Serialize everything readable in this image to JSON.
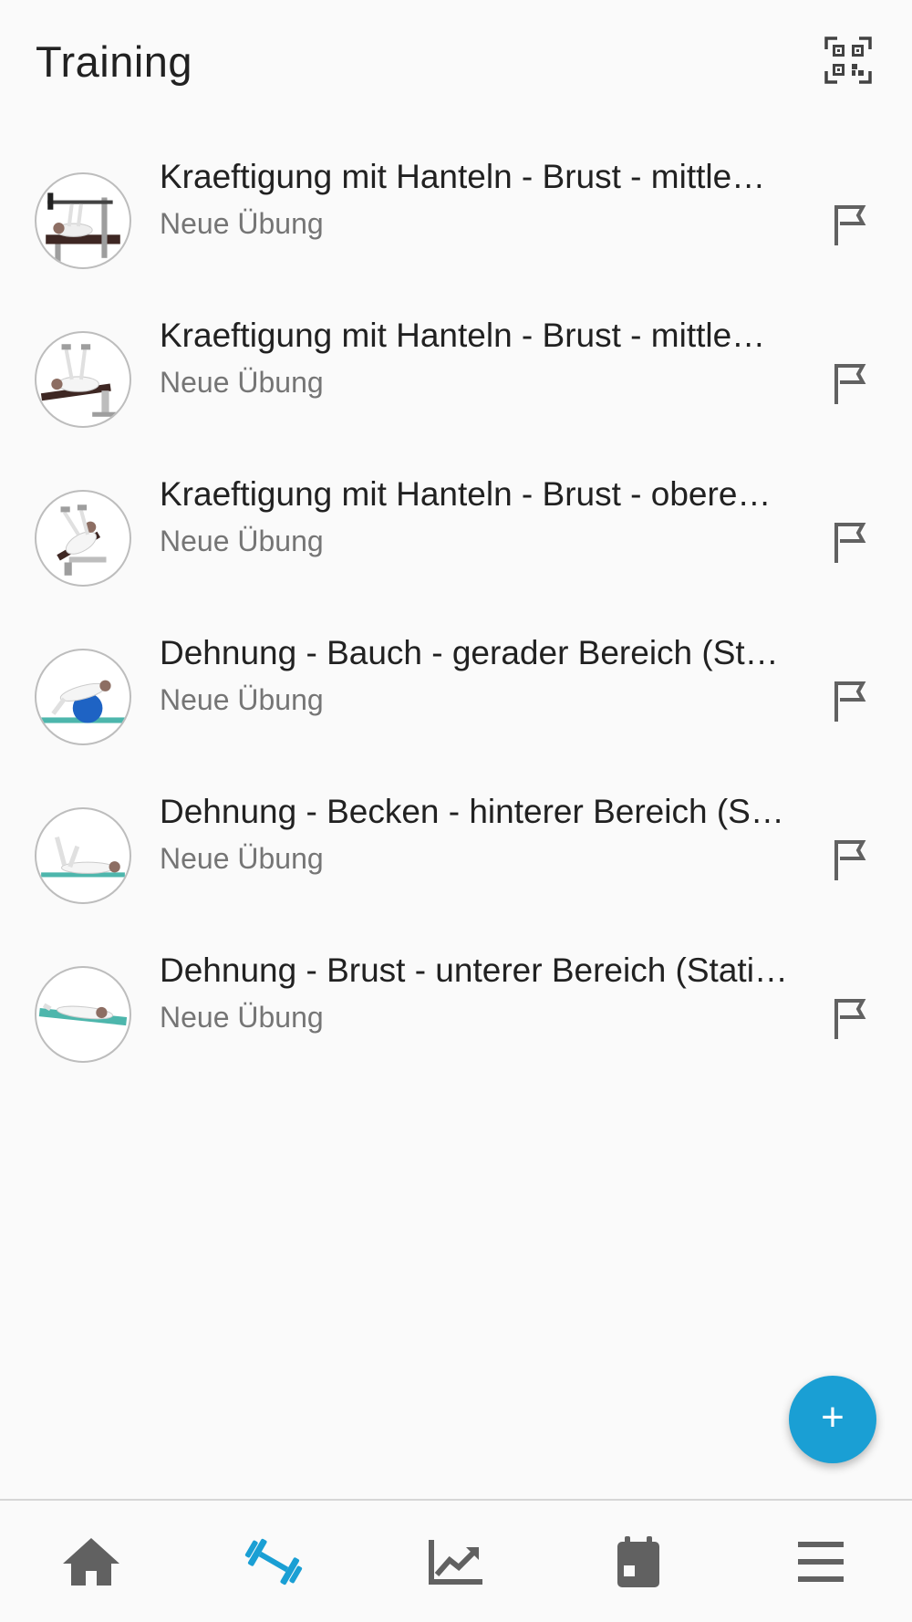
{
  "header": {
    "title": "Training",
    "qr_icon": "qr-code-scan-icon"
  },
  "exercises": [
    {
      "title": "Kraeftigung mit Hanteln - Brust - mittle…",
      "subtitle": "Neue Übung",
      "thumb": "bench-press-barbell"
    },
    {
      "title": "Kraeftigung mit Hanteln - Brust - mittle…",
      "subtitle": "Neue Übung",
      "thumb": "bench-dumbbell-fly"
    },
    {
      "title": "Kraeftigung mit Hanteln - Brust - obere…",
      "subtitle": "Neue Übung",
      "thumb": "incline-dumbbell-press"
    },
    {
      "title": "Dehnung - Bauch - gerader Bereich (St…",
      "subtitle": "Neue Übung",
      "thumb": "stretch-on-ball"
    },
    {
      "title": "Dehnung - Becken - hinterer Bereich (S…",
      "subtitle": "Neue Übung",
      "thumb": "floor-leg-stretch"
    },
    {
      "title": "Dehnung - Brust - unterer Bereich (Stati…",
      "subtitle": "Neue Übung",
      "thumb": "floor-chest-stretch"
    }
  ],
  "fab": {
    "label": "+"
  },
  "bottom_nav": [
    {
      "name": "home",
      "icon": "home-icon",
      "active": false
    },
    {
      "name": "training",
      "icon": "dumbbell-icon",
      "active": true
    },
    {
      "name": "progress",
      "icon": "trending-up-icon",
      "active": false
    },
    {
      "name": "calendar",
      "icon": "calendar-icon",
      "active": false
    },
    {
      "name": "menu",
      "icon": "menu-icon",
      "active": false
    }
  ],
  "colors": {
    "accent": "#1a9fd4",
    "icon_gray": "#616161",
    "text_primary": "#212121",
    "text_secondary": "#757575",
    "background": "#fafafa"
  }
}
